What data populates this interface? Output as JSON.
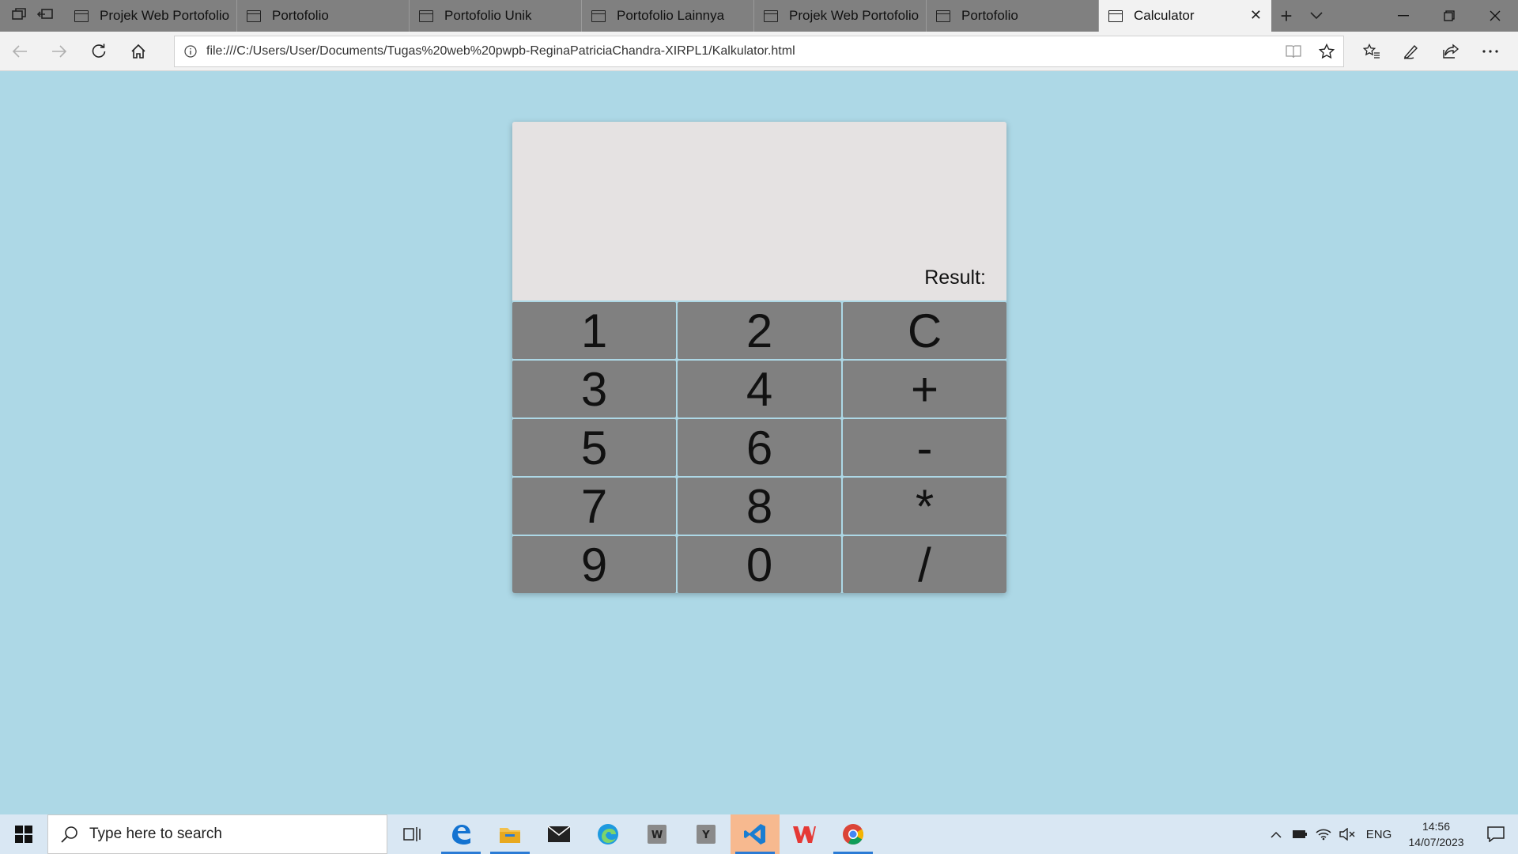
{
  "browser": {
    "tabs": [
      {
        "label": "Projek Web Portofolio",
        "active": false
      },
      {
        "label": "Portofolio",
        "active": false
      },
      {
        "label": "Portofolio Unik",
        "active": false
      },
      {
        "label": "Portofolio Lainnya",
        "active": false
      },
      {
        "label": "Projek Web Portofolio",
        "active": false
      },
      {
        "label": "Portofolio",
        "active": false
      },
      {
        "label": "Calculator",
        "active": true
      }
    ],
    "address": "file:///C:/Users/User/Documents/Tugas%20web%20pwpb-ReginaPatriciaChandra-XIRPL1/Kalkulator.html"
  },
  "calculator": {
    "result_label": "Result:",
    "keys": [
      {
        "label": "1",
        "name": "key-1"
      },
      {
        "label": "2",
        "name": "key-2"
      },
      {
        "label": "C",
        "name": "key-clear"
      },
      {
        "label": "3",
        "name": "key-3"
      },
      {
        "label": "4",
        "name": "key-4"
      },
      {
        "label": "+",
        "name": "key-add"
      },
      {
        "label": "5",
        "name": "key-5"
      },
      {
        "label": "6",
        "name": "key-6"
      },
      {
        "label": "-",
        "name": "key-subtract"
      },
      {
        "label": "7",
        "name": "key-7"
      },
      {
        "label": "8",
        "name": "key-8"
      },
      {
        "label": "*",
        "name": "key-multiply"
      },
      {
        "label": "9",
        "name": "key-9"
      },
      {
        "label": "0",
        "name": "key-0"
      },
      {
        "label": "/",
        "name": "key-divide"
      }
    ]
  },
  "taskbar": {
    "search_placeholder": "Type here to search",
    "apps": [
      {
        "name": "task-view-icon"
      },
      {
        "name": "edge-legacy-icon"
      },
      {
        "name": "file-explorer-icon"
      },
      {
        "name": "mail-icon"
      },
      {
        "name": "edge-icon"
      },
      {
        "name": "wps-writer-icon"
      },
      {
        "name": "yandex-icon"
      },
      {
        "name": "vscode-icon"
      },
      {
        "name": "wps-office-icon"
      },
      {
        "name": "chrome-icon"
      }
    ],
    "language": "ENG",
    "time": "14:56",
    "date": "14/07/2023"
  },
  "colors": {
    "page_background": "#add8e6",
    "display_background": "#e5e2e2",
    "key_background": "#808080"
  }
}
